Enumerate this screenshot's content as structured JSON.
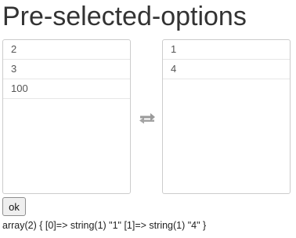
{
  "page": {
    "title": "Pre-selected-options"
  },
  "source_list": {
    "items": [
      "2",
      "3",
      "100"
    ]
  },
  "selected_list": {
    "items": [
      "1",
      "4"
    ]
  },
  "transfer": {
    "icon": "swap-arrows-icon"
  },
  "form": {
    "ok_label": "ok"
  },
  "output": {
    "text": "array(2) { [0]=> string(1) \"1\" [1]=> string(1) \"4\" }"
  },
  "colors": {
    "text": "#333333",
    "border": "#cccccc",
    "icon": "#999999"
  }
}
